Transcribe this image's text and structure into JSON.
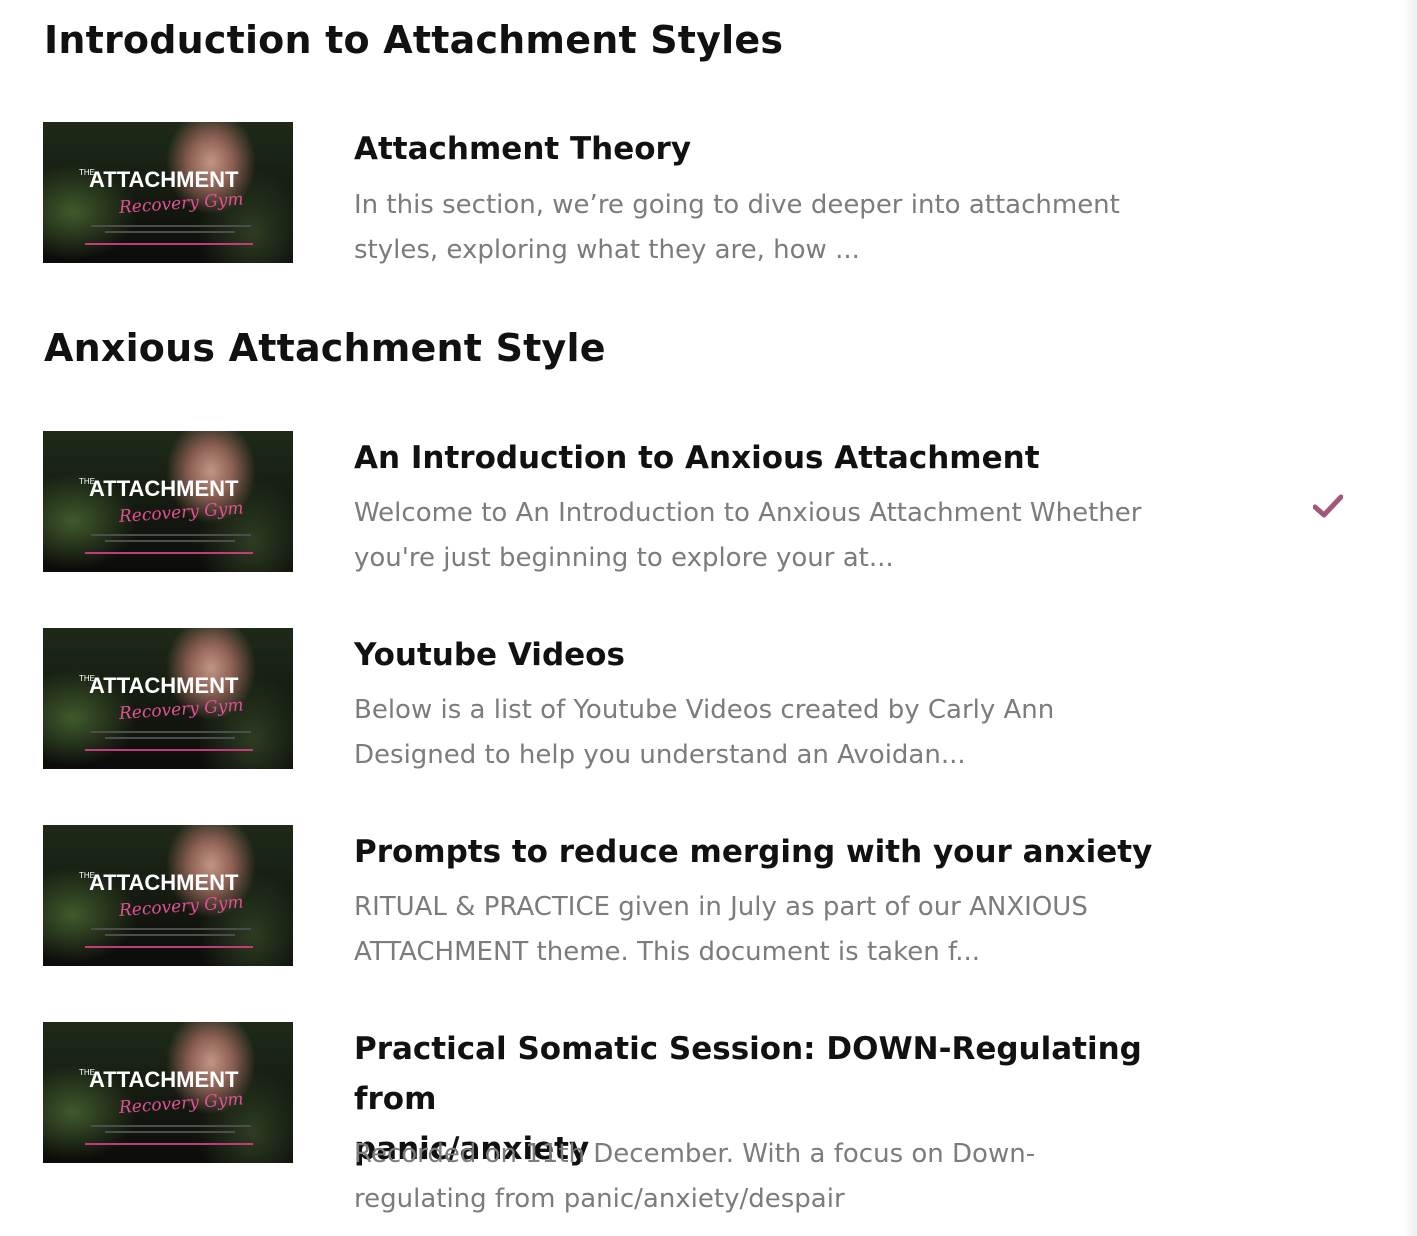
{
  "thumbnail": {
    "prefix": "THE",
    "headline": "ATTACHMENT",
    "script": "Recovery Gym"
  },
  "sections": [
    {
      "title": "Introduction to Attachment Styles",
      "lessons": [
        {
          "title": "Attachment Theory",
          "desc_lines": [
            "In this section, we’re going to dive deeper into attachment",
            "styles, exploring what they are, how ..."
          ],
          "completed": false
        }
      ]
    },
    {
      "title": "Anxious Attachment Style",
      "lessons": [
        {
          "title": "An Introduction to Anxious Attachment",
          "desc_lines": [
            "Welcome to An Introduction to Anxious Attachment Whether",
            "you're just beginning to explore your at..."
          ],
          "completed": true
        },
        {
          "title": "Youtube Videos",
          "desc_lines": [
            "Below is a list of Youtube Videos created by Carly Ann",
            "Designed to help you understand an Avoidan..."
          ],
          "completed": false
        },
        {
          "title": "Prompts to reduce merging with your anxiety",
          "desc_lines": [
            "RITUAL & PRACTICE given in July as part of our ANXIOUS",
            "ATTACHMENT theme. This document is taken f..."
          ],
          "completed": false
        },
        {
          "title_lines": [
            "Practical Somatic Session: DOWN-Regulating from",
            "panic/anxiety"
          ],
          "desc_lines": [
            "Recorded on 11th December. With a focus on Down-",
            "regulating from panic/anxiety/despair"
          ],
          "completed": false
        }
      ]
    }
  ],
  "colors": {
    "heading": "#111111",
    "description": "#7c7c7c",
    "check": "#a2567e",
    "script_pink": "#e24f95"
  },
  "icons": {
    "completed": "check-icon"
  }
}
